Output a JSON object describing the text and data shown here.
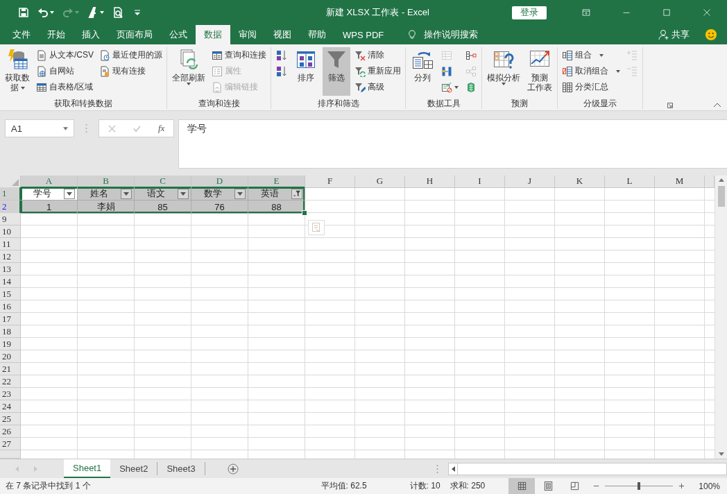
{
  "window": {
    "title": "新建 XLSX 工作表  -  Excel",
    "sign_in": "登录"
  },
  "quick_access": [
    {
      "kind": "save",
      "disabled": false,
      "dropdown": false
    },
    {
      "kind": "undo",
      "disabled": false,
      "dropdown": true
    },
    {
      "kind": "redo",
      "disabled": true,
      "dropdown": true
    },
    {
      "kind": "pen",
      "disabled": false,
      "dropdown": true
    },
    {
      "kind": "preview",
      "disabled": false,
      "dropdown": false
    },
    {
      "kind": "customize",
      "disabled": false,
      "dropdown": false
    }
  ],
  "ribbon_tabs": [
    {
      "label": "文件",
      "selected": false
    },
    {
      "label": "开始",
      "selected": false
    },
    {
      "label": "插入",
      "selected": false
    },
    {
      "label": "页面布局",
      "selected": false
    },
    {
      "label": "公式",
      "selected": false
    },
    {
      "label": "数据",
      "selected": true
    },
    {
      "label": "审阅",
      "selected": false
    },
    {
      "label": "视图",
      "selected": false
    },
    {
      "label": "帮助",
      "selected": false
    },
    {
      "label": "WPS PDF",
      "selected": false
    }
  ],
  "tell_me": "操作说明搜索",
  "share": "共享",
  "ribbon_groups": [
    {
      "label": "获取和转换数据",
      "columns": [
        {
          "kind": "large",
          "items": [
            {
              "kind": "database",
              "lines": [
                "获取数",
                "据"
              ],
              "dropdown": true,
              "disabled": false,
              "selected": false
            }
          ]
        },
        {
          "kind": "small",
          "items": [
            {
              "kind": "textfile",
              "label": "从文本/CSV",
              "dropdown": false,
              "disabled": false
            },
            {
              "kind": "web",
              "label": "自网站",
              "dropdown": false,
              "disabled": false
            },
            {
              "kind": "table",
              "label": "自表格/区域",
              "dropdown": false,
              "disabled": false
            }
          ]
        },
        {
          "kind": "small",
          "items": [
            {
              "kind": "recent",
              "label": "最近使用的源",
              "dropdown": false,
              "disabled": false
            },
            {
              "kind": "existing",
              "label": "现有连接",
              "dropdown": false,
              "disabled": false
            }
          ]
        }
      ]
    },
    {
      "label": "查询和连接",
      "columns": [
        {
          "kind": "large",
          "items": [
            {
              "kind": "refresh",
              "lines": [
                "全部刷新"
              ],
              "dropdown": true,
              "disabled": false,
              "selected": false
            }
          ]
        },
        {
          "kind": "small",
          "items": [
            {
              "kind": "queries",
              "label": "查询和连接",
              "dropdown": false,
              "disabled": false
            },
            {
              "kind": "properties",
              "label": "属性",
              "dropdown": false,
              "disabled": true
            },
            {
              "kind": "links",
              "label": "编辑链接",
              "dropdown": false,
              "disabled": true
            }
          ]
        }
      ]
    },
    {
      "label": "排序和筛选",
      "columns": [
        {
          "kind": "icon",
          "items": [
            {
              "kind": "sortaz",
              "dropdown": false,
              "disabled": false
            },
            {
              "kind": "sortza",
              "dropdown": false,
              "disabled": false
            }
          ]
        },
        {
          "kind": "large",
          "items": [
            {
              "kind": "sort",
              "lines": [
                "排序"
              ],
              "dropdown": false,
              "disabled": false,
              "selected": false
            }
          ]
        },
        {
          "kind": "large",
          "items": [
            {
              "kind": "filter",
              "lines": [
                "筛选"
              ],
              "dropdown": false,
              "disabled": false,
              "selected": true
            }
          ]
        },
        {
          "kind": "small",
          "items": [
            {
              "kind": "clear",
              "label": "清除",
              "dropdown": false,
              "disabled": false
            },
            {
              "kind": "reapply",
              "label": "重新应用",
              "dropdown": false,
              "disabled": false
            },
            {
              "kind": "advanced",
              "label": "高级",
              "dropdown": false,
              "disabled": false
            }
          ]
        }
      ]
    },
    {
      "label": "数据工具",
      "columns": [
        {
          "kind": "large",
          "items": [
            {
              "kind": "split",
              "lines": [
                "分列"
              ],
              "dropdown": false,
              "disabled": false,
              "selected": false
            }
          ]
        },
        {
          "kind": "icon",
          "items": [
            {
              "kind": "flashfill",
              "dropdown": false,
              "disabled": true
            },
            {
              "kind": "duplicates",
              "dropdown": false,
              "disabled": false
            },
            {
              "kind": "validation",
              "dropdown": true,
              "disabled": false
            }
          ]
        },
        {
          "kind": "icon",
          "items": [
            {
              "kind": "consolidate",
              "dropdown": false,
              "disabled": false
            },
            {
              "kind": "relationships",
              "dropdown": false,
              "disabled": true
            },
            {
              "kind": "datamodel",
              "dropdown": false,
              "disabled": false
            }
          ]
        }
      ]
    },
    {
      "label": "预测",
      "columns": [
        {
          "kind": "large",
          "items": [
            {
              "kind": "whatif",
              "lines": [
                "模拟分析"
              ],
              "dropdown": true,
              "disabled": false,
              "selected": false
            }
          ]
        },
        {
          "kind": "large",
          "items": [
            {
              "kind": "forecast",
              "lines": [
                "预测",
                "工作表"
              ],
              "dropdown": false,
              "disabled": false,
              "selected": false
            }
          ]
        }
      ]
    },
    {
      "label": "分级显示",
      "columns": [
        {
          "kind": "small",
          "items": [
            {
              "kind": "group",
              "label": "组合",
              "dropdown": true,
              "disabled": false
            },
            {
              "kind": "ungroup",
              "label": "取消组合",
              "dropdown": true,
              "disabled": false
            },
            {
              "kind": "subtotal",
              "label": "分类汇总",
              "dropdown": false,
              "disabled": false
            }
          ]
        },
        {
          "kind": "icon",
          "items": [
            {
              "kind": "showdetail",
              "dropdown": false,
              "disabled": true
            },
            {
              "kind": "hidedetail",
              "dropdown": false,
              "disabled": true
            }
          ]
        }
      ]
    }
  ],
  "formula_bar": {
    "name_box": "A1",
    "function_label": "fx",
    "formula": "学号"
  },
  "sheet": {
    "columns": [
      {
        "letter": "A",
        "selected": true
      },
      {
        "letter": "B",
        "selected": true
      },
      {
        "letter": "C",
        "selected": true
      },
      {
        "letter": "D",
        "selected": true
      },
      {
        "letter": "E",
        "selected": true
      },
      {
        "letter": "F",
        "selected": false
      },
      {
        "letter": "G",
        "selected": false
      },
      {
        "letter": "H",
        "selected": false
      },
      {
        "letter": "I",
        "selected": false
      },
      {
        "letter": "J",
        "selected": false
      },
      {
        "letter": "K",
        "selected": false
      },
      {
        "letter": "L",
        "selected": false
      },
      {
        "letter": "M",
        "selected": false
      }
    ],
    "rows": [
      {
        "number": "1",
        "selected": true,
        "filtered": false,
        "cells": [
          {
            "text": "学号",
            "kind": "dropdown",
            "active": true
          },
          {
            "text": "姓名",
            "kind": "dropdown",
            "active": false
          },
          {
            "text": "语文",
            "kind": "dropdown",
            "active": false
          },
          {
            "text": "数学",
            "kind": "dropdown",
            "active": false
          },
          {
            "text": "英语",
            "kind": "filtered",
            "active": false
          }
        ]
      },
      {
        "number": "2",
        "selected": true,
        "filtered": true,
        "cells": [
          {
            "text": "1",
            "kind": "plain",
            "active": false
          },
          {
            "text": "李娟",
            "kind": "plain",
            "active": false
          },
          {
            "text": "85",
            "kind": "plain",
            "active": false
          },
          {
            "text": "76",
            "kind": "plain",
            "active": false
          },
          {
            "text": "88",
            "kind": "plain",
            "active": false
          }
        ]
      },
      {
        "number": "9",
        "selected": false,
        "filtered": false
      },
      {
        "number": "10",
        "selected": false,
        "filtered": false
      },
      {
        "number": "11",
        "selected": false,
        "filtered": false
      },
      {
        "number": "12",
        "selected": false,
        "filtered": false
      },
      {
        "number": "13",
        "selected": false,
        "filtered": false
      },
      {
        "number": "14",
        "selected": false,
        "filtered": false
      },
      {
        "number": "15",
        "selected": false,
        "filtered": false
      },
      {
        "number": "16",
        "selected": false,
        "filtered": false
      },
      {
        "number": "17",
        "selected": false,
        "filtered": false
      },
      {
        "number": "18",
        "selected": false,
        "filtered": false
      },
      {
        "number": "19",
        "selected": false,
        "filtered": false
      },
      {
        "number": "20",
        "selected": false,
        "filtered": false
      },
      {
        "number": "21",
        "selected": false,
        "filtered": false
      },
      {
        "number": "22",
        "selected": false,
        "filtered": false
      },
      {
        "number": "23",
        "selected": false,
        "filtered": false
      },
      {
        "number": "24",
        "selected": false,
        "filtered": false
      },
      {
        "number": "25",
        "selected": false,
        "filtered": false
      },
      {
        "number": "26",
        "selected": false,
        "filtered": false
      },
      {
        "number": "27",
        "selected": false,
        "filtered": false
      }
    ]
  },
  "sheet_tabs": [
    {
      "label": "Sheet1",
      "selected": true
    },
    {
      "label": "Sheet2",
      "selected": false
    },
    {
      "label": "Sheet3",
      "selected": false
    }
  ],
  "status_bar": {
    "message": "在 7 条记录中找到 1 个",
    "average": "平均值: 62.5",
    "count": "计数: 10",
    "sum": "求和: 250",
    "views": [
      {
        "kind": "normal",
        "selected": true
      },
      {
        "kind": "layout",
        "selected": false
      },
      {
        "kind": "pagebreak",
        "selected": false
      }
    ],
    "zoom": {
      "level": 0.5,
      "label": "100%"
    }
  }
}
